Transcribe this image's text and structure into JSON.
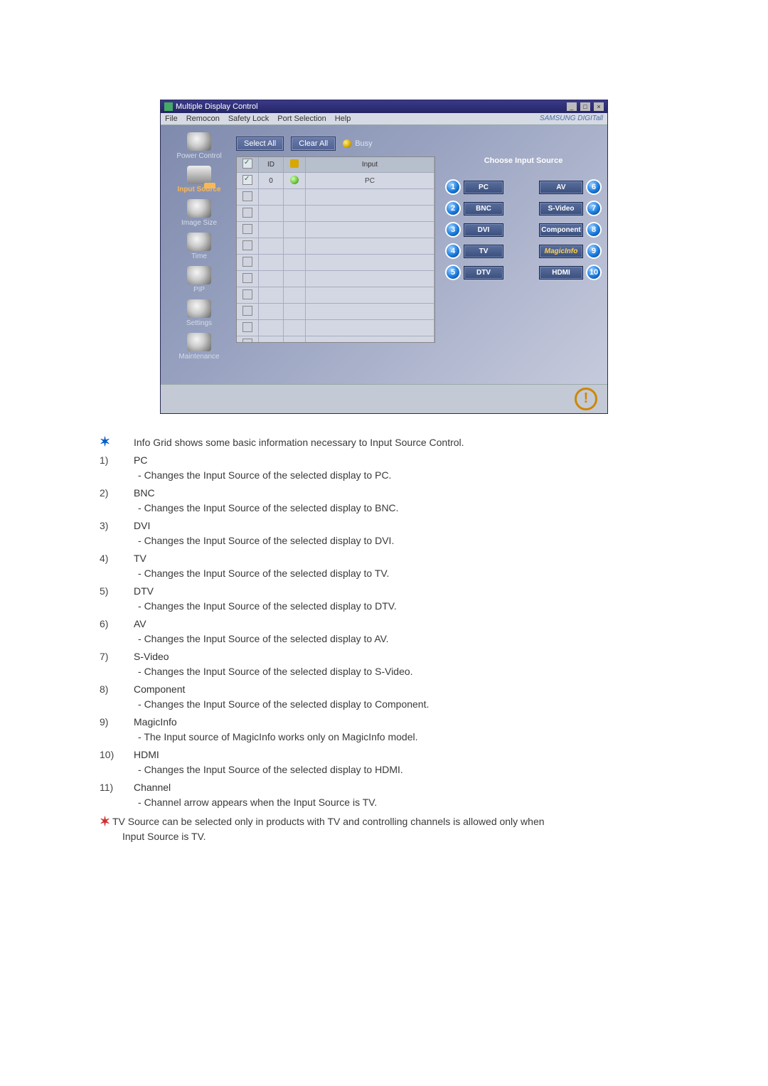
{
  "window": {
    "title": "Multiple Display Control",
    "menu": [
      "File",
      "Remocon",
      "Safety Lock",
      "Port Selection",
      "Help"
    ],
    "brand": "SAMSUNG DIGITall"
  },
  "sidebar": {
    "items": [
      {
        "label": "Power Control"
      },
      {
        "label": "Input Source",
        "active": true
      },
      {
        "label": "Image Size"
      },
      {
        "label": "Time"
      },
      {
        "label": "PIP"
      },
      {
        "label": "Settings"
      },
      {
        "label": "Maintenance"
      }
    ]
  },
  "toolbar": {
    "select_all": "Select All",
    "clear_all": "Clear All",
    "busy": "Busy"
  },
  "grid": {
    "headers": {
      "check": "✓",
      "id": "ID",
      "status": "",
      "input": "Input"
    },
    "row": {
      "id": "0",
      "input": "PC"
    }
  },
  "right": {
    "title": "Choose Input Source",
    "left": [
      {
        "num": "1",
        "label": "PC"
      },
      {
        "num": "2",
        "label": "BNC"
      },
      {
        "num": "3",
        "label": "DVI"
      },
      {
        "num": "4",
        "label": "TV"
      },
      {
        "num": "5",
        "label": "DTV"
      }
    ],
    "right": [
      {
        "num": "6",
        "label": "AV"
      },
      {
        "num": "7",
        "label": "S-Video"
      },
      {
        "num": "8",
        "label": "Component"
      },
      {
        "num": "9",
        "label": "MagicInfo"
      },
      {
        "num": "10",
        "label": "HDMI"
      }
    ]
  },
  "doc": {
    "intro": "Info Grid shows some basic information necessary to Input Source Control.",
    "items": [
      {
        "num": "1)",
        "name": "PC",
        "desc": "Changes the Input Source of the selected display to PC."
      },
      {
        "num": "2)",
        "name": "BNC",
        "desc": "Changes the Input Source of the selected display to BNC."
      },
      {
        "num": "3)",
        "name": "DVI",
        "desc": "Changes the Input Source of the selected display to DVI."
      },
      {
        "num": "4)",
        "name": "TV",
        "desc": "Changes the Input Source of the selected display to TV."
      },
      {
        "num": "5)",
        "name": "DTV",
        "desc": "Changes the Input Source of the selected display to DTV."
      },
      {
        "num": "6)",
        "name": "AV",
        "desc": "Changes the Input Source of the selected display to AV."
      },
      {
        "num": "7)",
        "name": "S-Video",
        "desc": "Changes the Input Source of the selected display to S-Video."
      },
      {
        "num": "8)",
        "name": "Component",
        "desc": "Changes the Input Source of the selected display to Component."
      },
      {
        "num": "9)",
        "name": "MagicInfo",
        "desc": "The Input source of MagicInfo works only on MagicInfo model."
      },
      {
        "num": "10)",
        "name": "HDMI",
        "desc": "Changes the Input Source of the selected display to HDMI."
      },
      {
        "num": "11)",
        "name": "Channel",
        "desc": "Channel arrow appears when the Input Source is TV."
      }
    ],
    "note_line1": "TV Source can be selected only in products with TV and controlling channels is allowed only when",
    "note_line2": "Input Source is TV."
  }
}
